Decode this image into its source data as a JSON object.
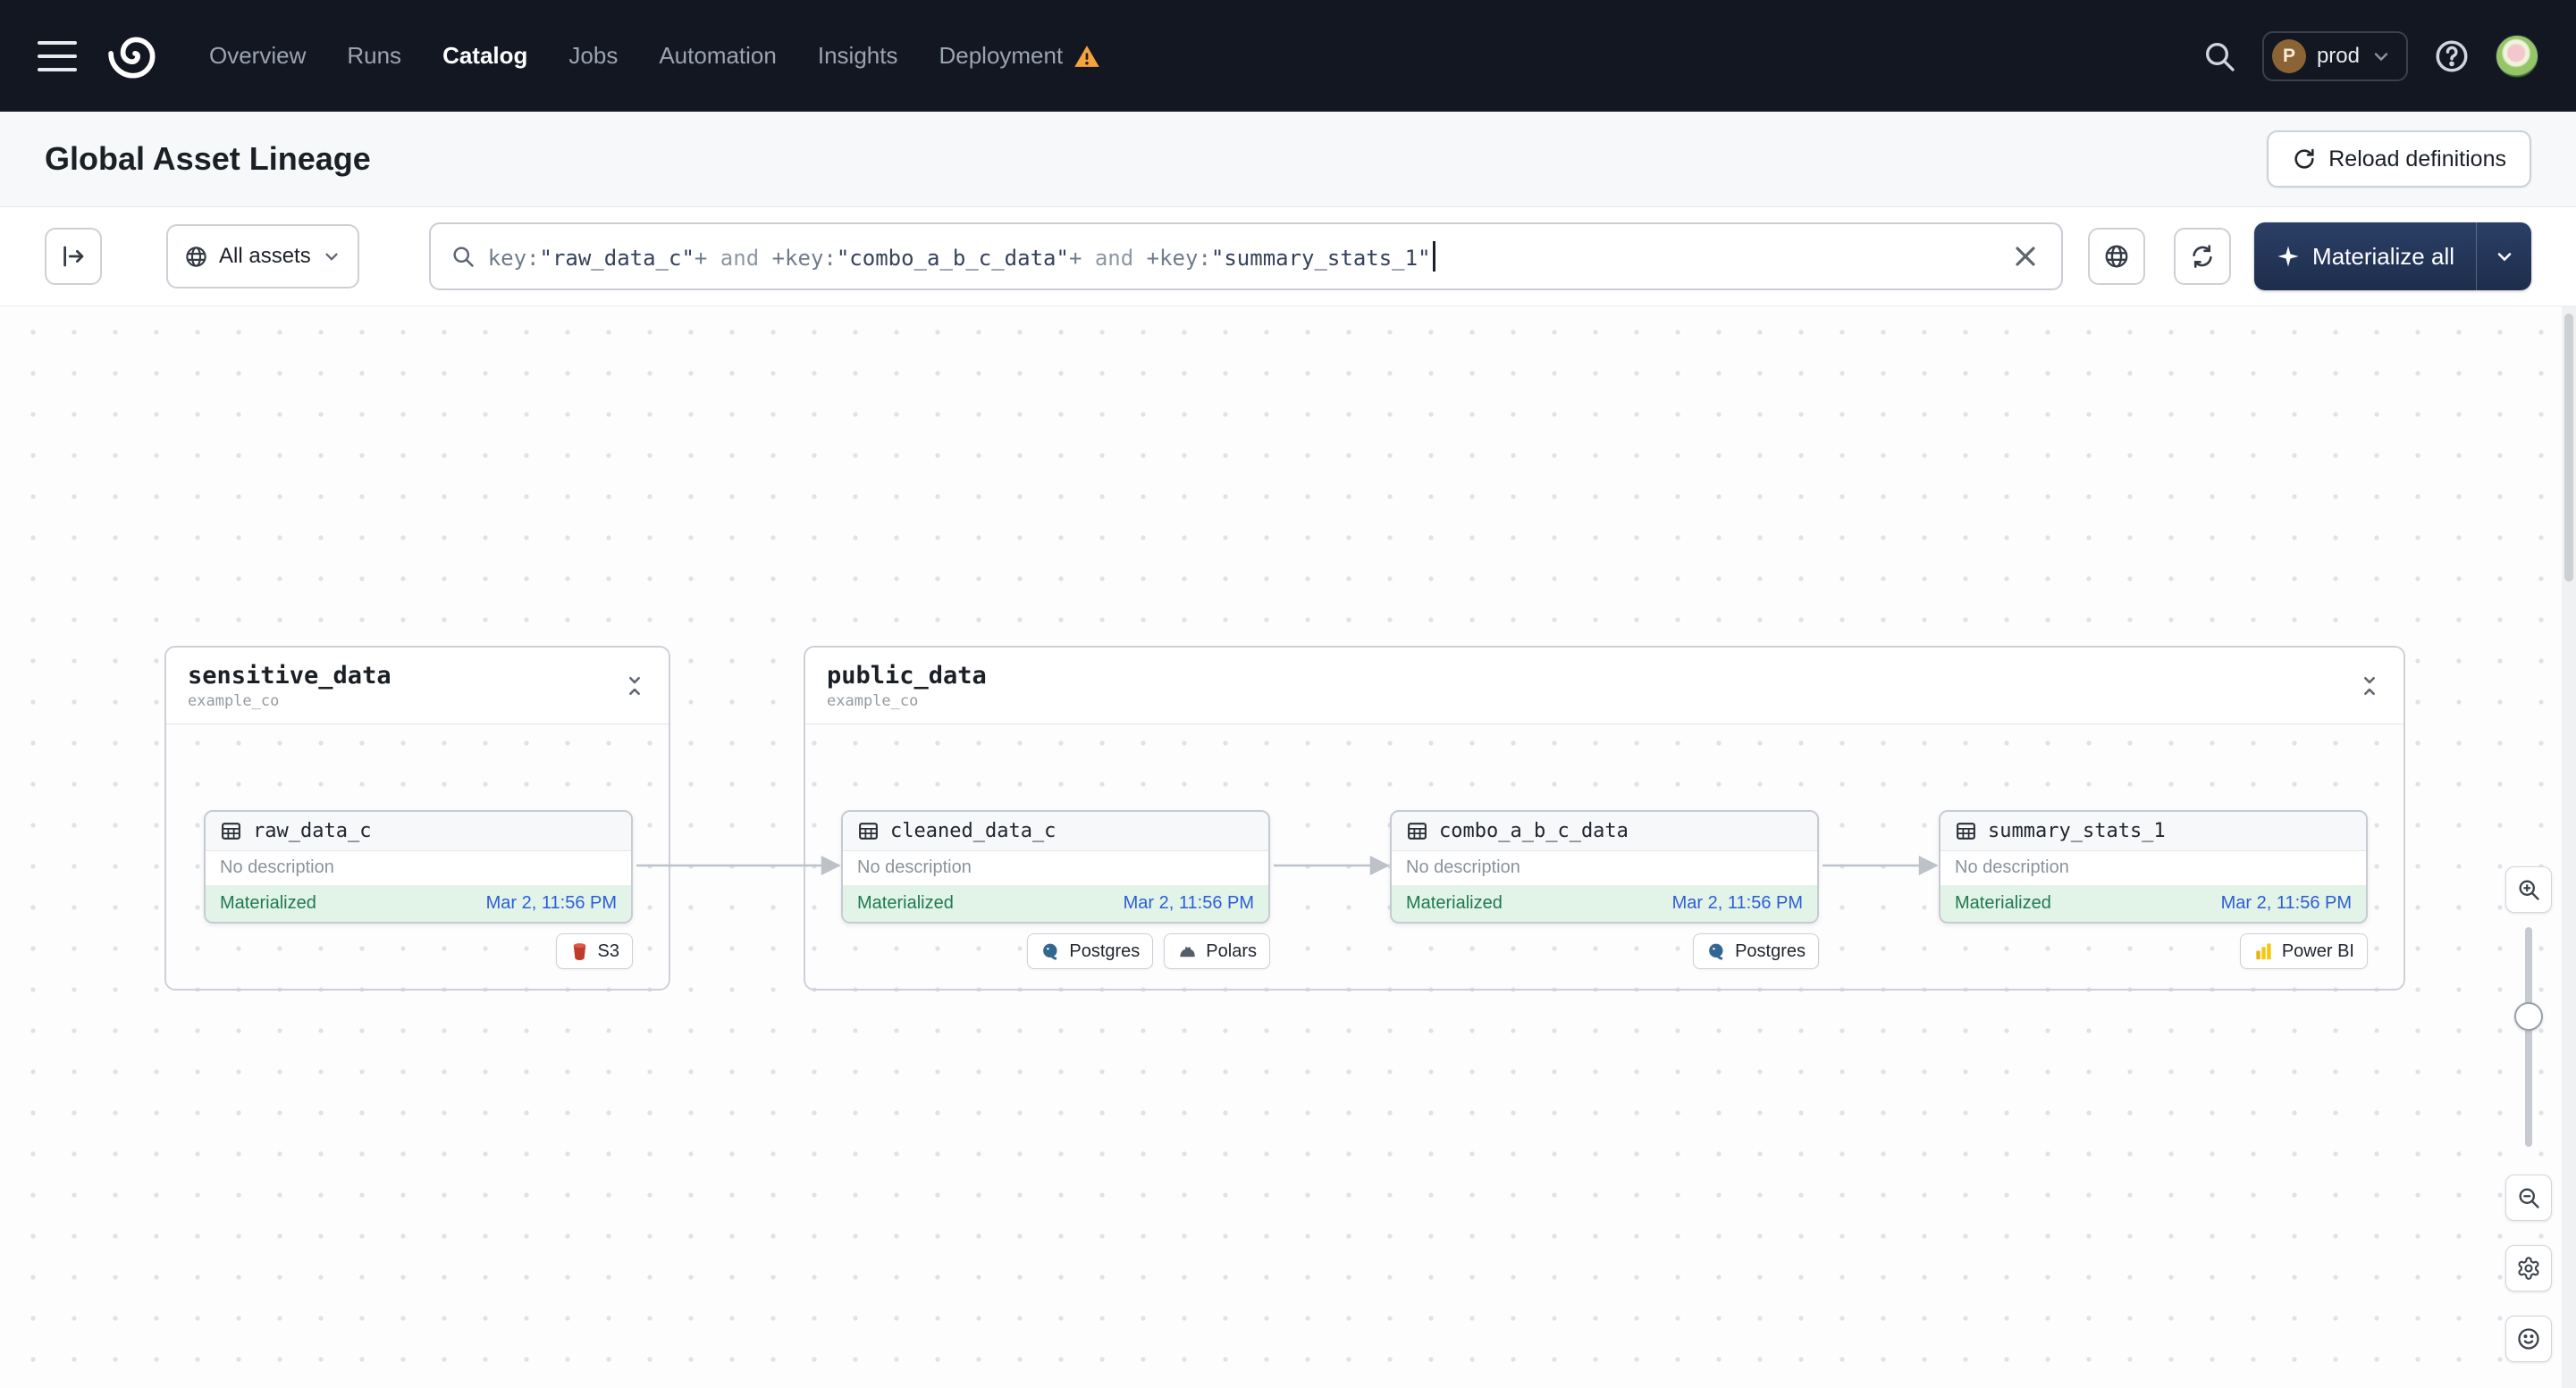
{
  "navbar": {
    "links": [
      {
        "label": "Overview"
      },
      {
        "label": "Runs"
      },
      {
        "label": "Catalog",
        "active": true
      },
      {
        "label": "Jobs"
      },
      {
        "label": "Automation"
      },
      {
        "label": "Insights"
      },
      {
        "label": "Deployment",
        "warning": true
      }
    ],
    "env_switcher": {
      "initial": "P",
      "name": "prod"
    }
  },
  "page_header": {
    "title": "Global Asset Lineage",
    "reload_button_label": "Reload definitions"
  },
  "toolbar": {
    "asset_filter_label": "All assets",
    "query_tokens": [
      {
        "text": "key:",
        "kind": "attr"
      },
      {
        "text": "\"raw_data_c\"",
        "kind": "value"
      },
      {
        "text": "+",
        "kind": "op"
      },
      {
        "text": " and ",
        "kind": "keyword"
      },
      {
        "text": "+",
        "kind": "op"
      },
      {
        "text": "key:",
        "kind": "attr"
      },
      {
        "text": "\"combo_a_b_c_data\"",
        "kind": "value"
      },
      {
        "text": "+",
        "kind": "op"
      },
      {
        "text": " and ",
        "kind": "keyword"
      },
      {
        "text": "+",
        "kind": "op"
      },
      {
        "text": "key:",
        "kind": "attr"
      },
      {
        "text": "\"summary_stats_1\"",
        "kind": "value"
      }
    ],
    "materialize_button_label": "Materialize all"
  },
  "graph": {
    "groups": [
      {
        "name": "sensitive_data",
        "location": "example_co",
        "nodes": [
          {
            "name": "raw_data_c",
            "description": "No description",
            "status": "Materialized",
            "timestamp": "Mar 2, 11:56 PM",
            "tags": [
              {
                "label": "S3",
                "icon": "s3-icon"
              }
            ]
          }
        ]
      },
      {
        "name": "public_data",
        "location": "example_co",
        "nodes": [
          {
            "name": "cleaned_data_c",
            "description": "No description",
            "status": "Materialized",
            "timestamp": "Mar 2, 11:56 PM",
            "tags": [
              {
                "label": "Postgres",
                "icon": "postgres-icon"
              },
              {
                "label": "Polars",
                "icon": "polars-icon"
              }
            ]
          },
          {
            "name": "combo_a_b_c_data",
            "description": "No description",
            "status": "Materialized",
            "timestamp": "Mar 2, 11:56 PM",
            "tags": [
              {
                "label": "Postgres",
                "icon": "postgres-icon"
              }
            ]
          },
          {
            "name": "summary_stats_1",
            "description": "No description",
            "status": "Materialized",
            "timestamp": "Mar 2, 11:56 PM",
            "tags": [
              {
                "label": "Power BI",
                "icon": "powerbi-icon"
              }
            ]
          }
        ]
      }
    ]
  },
  "colors": {
    "navbar_bg": "#131722",
    "warning": "#f7a33c",
    "materialized_bg": "#e2f4e8",
    "materialized_text": "#1f7a4d",
    "timestamp_link": "#2d5dd7",
    "primary_button_bg": "#22335b"
  }
}
